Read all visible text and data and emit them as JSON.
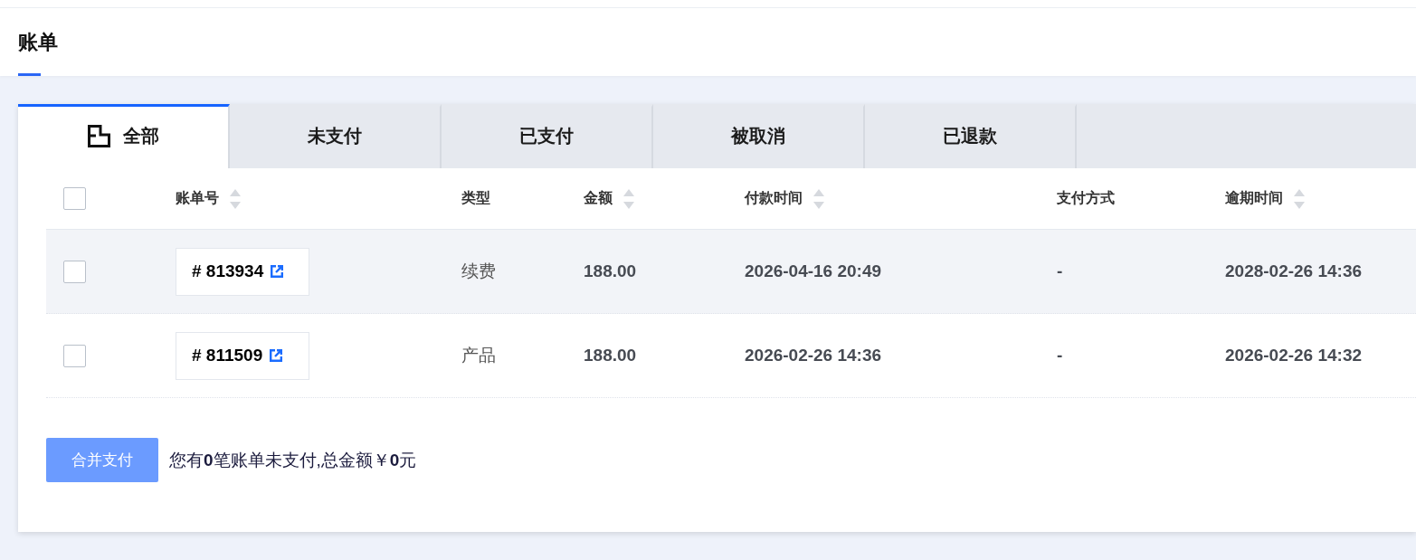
{
  "page": {
    "title": "账单"
  },
  "tabs": [
    {
      "label": "全部",
      "selected": true
    },
    {
      "label": "未支付",
      "selected": false
    },
    {
      "label": "已支付",
      "selected": false
    },
    {
      "label": "被取消",
      "selected": false
    },
    {
      "label": "已退款",
      "selected": false
    }
  ],
  "table": {
    "select_all": {
      "checked": false
    },
    "columns": [
      {
        "label": "账单号",
        "sortable": true
      },
      {
        "label": "类型",
        "sortable": false
      },
      {
        "label": "金额",
        "sortable": true
      },
      {
        "label": "付款时间",
        "sortable": true
      },
      {
        "label": "支付方式",
        "sortable": false
      },
      {
        "label": "逾期时间",
        "sortable": true
      }
    ],
    "rows": [
      {
        "checked": false,
        "highlighted": true,
        "bill_no": "# 813934",
        "type": "续费",
        "amount": "188.00",
        "paid_at": "2026-04-16 20:49",
        "payment_method": "-",
        "due_at": "2028-02-26 14:36"
      },
      {
        "checked": false,
        "highlighted": false,
        "bill_no": "# 811509",
        "type": "产品",
        "amount": "188.00",
        "paid_at": "2026-02-26 14:36",
        "payment_method": "-",
        "due_at": "2026-02-26 14:32"
      }
    ]
  },
  "footer": {
    "button": "合并支付",
    "summary": "您有**0**笔账单未支付,总金额￥**0**元"
  }
}
